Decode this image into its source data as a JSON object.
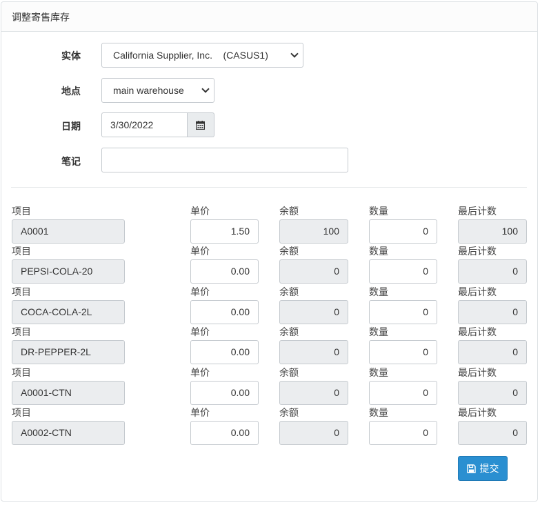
{
  "panel": {
    "title": "调整寄售库存"
  },
  "form": {
    "entity": {
      "label": "实体",
      "value": "California Supplier, Inc.    (CASUS1)"
    },
    "location": {
      "label": "地点",
      "value": "main warehouse"
    },
    "date": {
      "label": "日期",
      "value": "3/30/2022"
    },
    "note": {
      "label": "笔记",
      "value": ""
    }
  },
  "columns": {
    "item": "项目",
    "unit_price": "单价",
    "balance": "余额",
    "quantity": "数量",
    "last_count": "最后计数"
  },
  "rows": [
    {
      "item": "A0001",
      "unit_price": "1.50",
      "balance": "100",
      "quantity": "0",
      "last_count": "100"
    },
    {
      "item": "PEPSI-COLA-20",
      "unit_price": "0.00",
      "balance": "0",
      "quantity": "0",
      "last_count": "0"
    },
    {
      "item": "COCA-COLA-2L",
      "unit_price": "0.00",
      "balance": "0",
      "quantity": "0",
      "last_count": "0"
    },
    {
      "item": "DR-PEPPER-2L",
      "unit_price": "0.00",
      "balance": "0",
      "quantity": "0",
      "last_count": "0"
    },
    {
      "item": "A0001-CTN",
      "unit_price": "0.00",
      "balance": "0",
      "quantity": "0",
      "last_count": "0"
    },
    {
      "item": "A0002-CTN",
      "unit_price": "0.00",
      "balance": "0",
      "quantity": "0",
      "last_count": "0"
    }
  ],
  "submit": {
    "label": "提交",
    "icon": "save-icon"
  },
  "icons": {
    "date_button": "calendar-icon"
  },
  "colors": {
    "primary": "#2a8fd1",
    "readonly_bg": "#ebedef",
    "border": "#c4c9ce"
  }
}
